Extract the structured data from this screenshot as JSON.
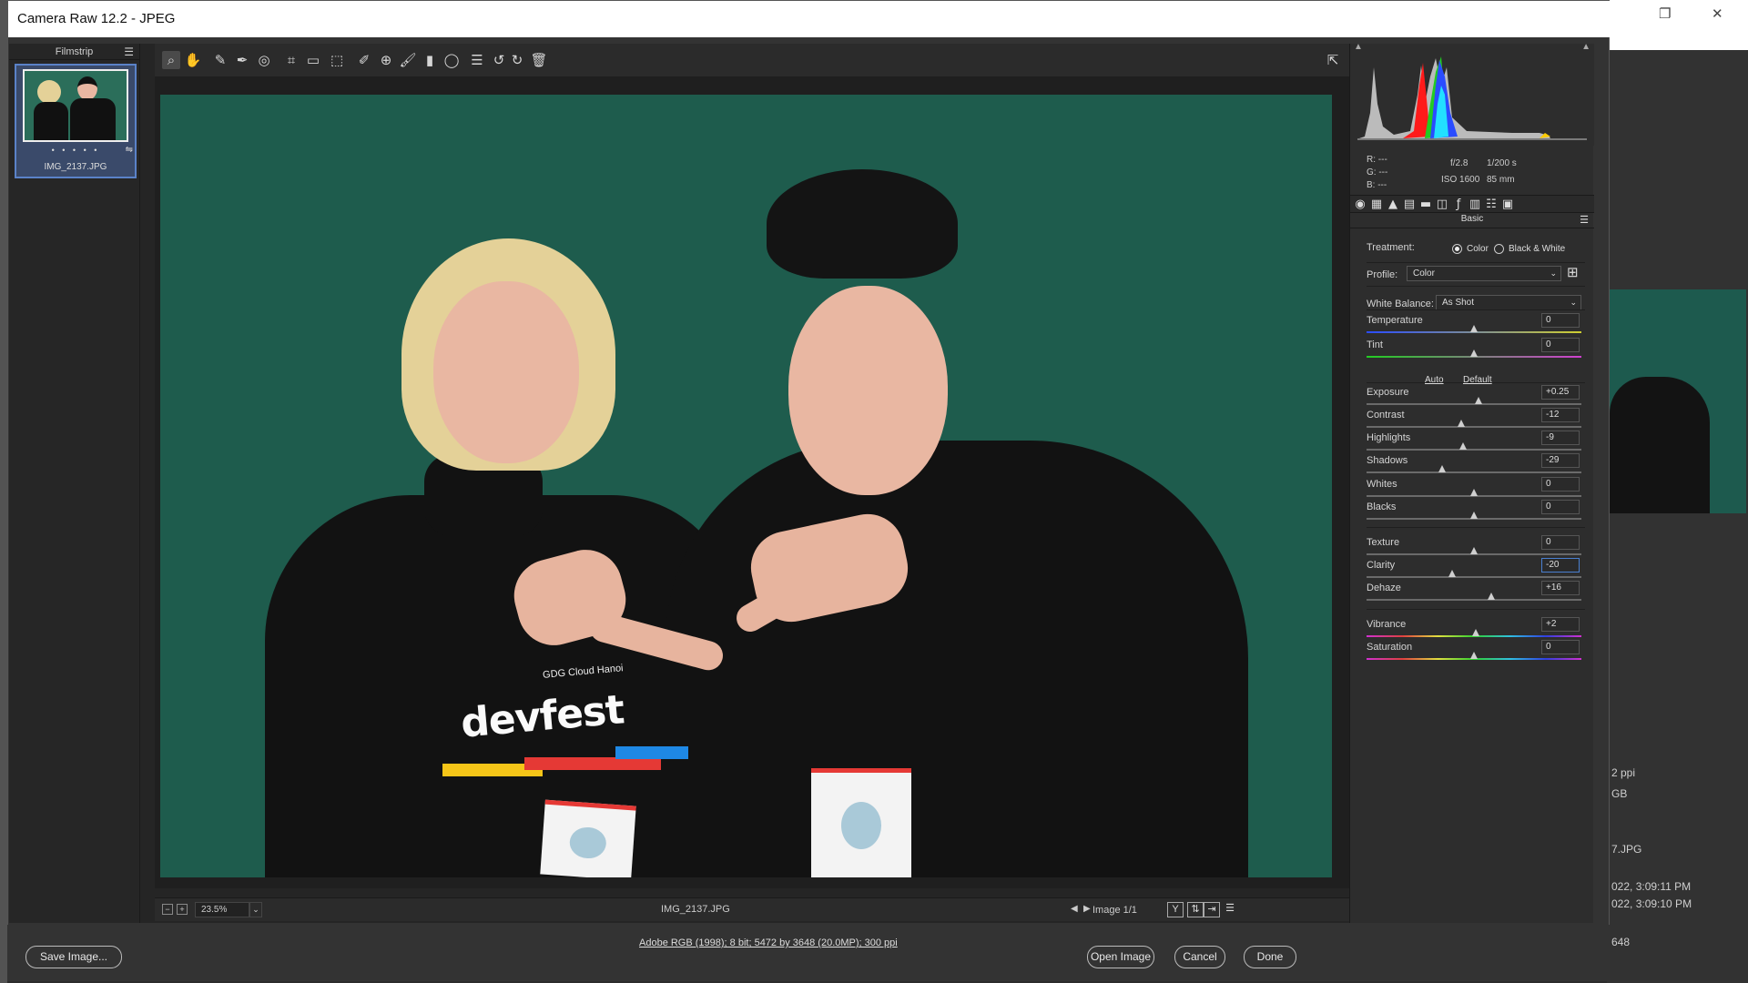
{
  "window": {
    "title": "Camera Raw 12.2  -  JPEG"
  },
  "background_app": {
    "fragments": [
      "2 ppi",
      "GB",
      "7.JPG",
      "022, 3:09:11 PM",
      "022, 3:09:10 PM",
      "648"
    ]
  },
  "filmstrip": {
    "header": "Filmstrip",
    "thumb": {
      "name": "IMG_2137.JPG",
      "rating": "• • • • •"
    }
  },
  "toolbar": {
    "tools": [
      "zoom-tool",
      "hand-tool",
      "white-balance-tool",
      "color-sampler-tool",
      "targeted-adjustment-tool",
      "crop-tool",
      "straighten-tool",
      "transform-tool",
      "spot-removal-tool",
      "red-eye-tool",
      "adjustment-brush-tool",
      "graduated-filter-tool",
      "radial-filter-tool",
      "preferences",
      "rotate-ccw",
      "rotate-cw",
      "delete"
    ]
  },
  "photo": {
    "shirt_text": "devfest",
    "shirt_sub": "GDG Cloud Hanoi",
    "colors": {
      "background": "#1e5c4d"
    }
  },
  "bottombar": {
    "zoom": "23.5%",
    "filename": "IMG_2137.JPG",
    "image_count": "Image 1/1",
    "view_y": "Y"
  },
  "histogram": {
    "rgb": {
      "r": "R:   ---",
      "g": "G:   ---",
      "b": "B:   ---"
    },
    "aperture": "f/2.8",
    "shutter": "1/200 s",
    "iso": "ISO 1600",
    "focal": "85 mm"
  },
  "panel": {
    "title": "Basic",
    "treatment_label": "Treatment:",
    "treatment_color": "Color",
    "treatment_bw": "Black & White",
    "profile_label": "Profile:",
    "profile_value": "Color",
    "wb_label": "White Balance:",
    "wb_value": "As Shot",
    "auto": "Auto",
    "default": "Default",
    "sliders": [
      {
        "label": "Temperature",
        "value": "0"
      },
      {
        "label": "Tint",
        "value": "0"
      },
      {
        "label": "Exposure",
        "value": "+0.25"
      },
      {
        "label": "Contrast",
        "value": "-12"
      },
      {
        "label": "Highlights",
        "value": "-9"
      },
      {
        "label": "Shadows",
        "value": "-29"
      },
      {
        "label": "Whites",
        "value": "0"
      },
      {
        "label": "Blacks",
        "value": "0"
      },
      {
        "label": "Texture",
        "value": "0"
      },
      {
        "label": "Clarity",
        "value": "-20"
      },
      {
        "label": "Dehaze",
        "value": "+16"
      },
      {
        "label": "Vibrance",
        "value": "+2"
      },
      {
        "label": "Saturation",
        "value": "0"
      }
    ]
  },
  "footer": {
    "save": "Save Image...",
    "meta": "Adobe RGB (1998); 8 bit; 5472 by 3648 (20.0MP); 300 ppi",
    "open": "Open Image",
    "cancel": "Cancel",
    "done": "Done"
  }
}
